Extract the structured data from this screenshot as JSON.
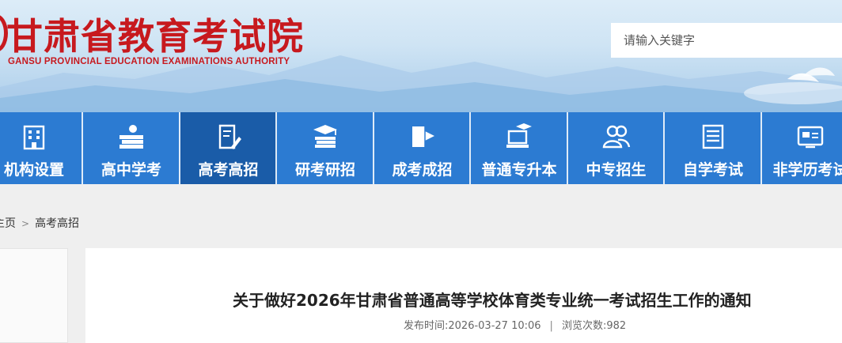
{
  "header": {
    "title_cn": "甘肃省教育考试院",
    "title_en": "GANSU PROVINCIAL EDUCATION EXAMINATIONS AUTHORITY",
    "search_placeholder": "请输入关键字"
  },
  "nav": {
    "items": [
      {
        "label": "机构设置",
        "icon": "building-icon"
      },
      {
        "label": "高中学考",
        "icon": "books-apple-icon"
      },
      {
        "label": "高考高招",
        "icon": "exam-paper-pen-icon",
        "active": true
      },
      {
        "label": "研考研招",
        "icon": "graduation-cap-books-icon"
      },
      {
        "label": "成考成招",
        "icon": "book-flag-icon"
      },
      {
        "label": "普通专升本",
        "icon": "laptop-grad-cap-icon"
      },
      {
        "label": "中专招生",
        "icon": "people-icon"
      },
      {
        "label": "自学考试",
        "icon": "document-lines-icon"
      },
      {
        "label": "非学历考试",
        "icon": "certificate-card-icon"
      }
    ]
  },
  "breadcrumb": {
    "home": "主页",
    "separator": ">",
    "current": "高考高招"
  },
  "article": {
    "title": "关于做好2026年甘肃省普通高等学校体育类专业统一考试招生工作的通知",
    "publish_label": "发布时间:",
    "publish_time": "2026-03-27 10:06",
    "divider": "|",
    "views_label": "浏览次数:",
    "views": "982"
  },
  "colors": {
    "brand_red": "#c7191e",
    "nav_blue": "#2c7bd2",
    "nav_active": "#1a5ca8"
  }
}
